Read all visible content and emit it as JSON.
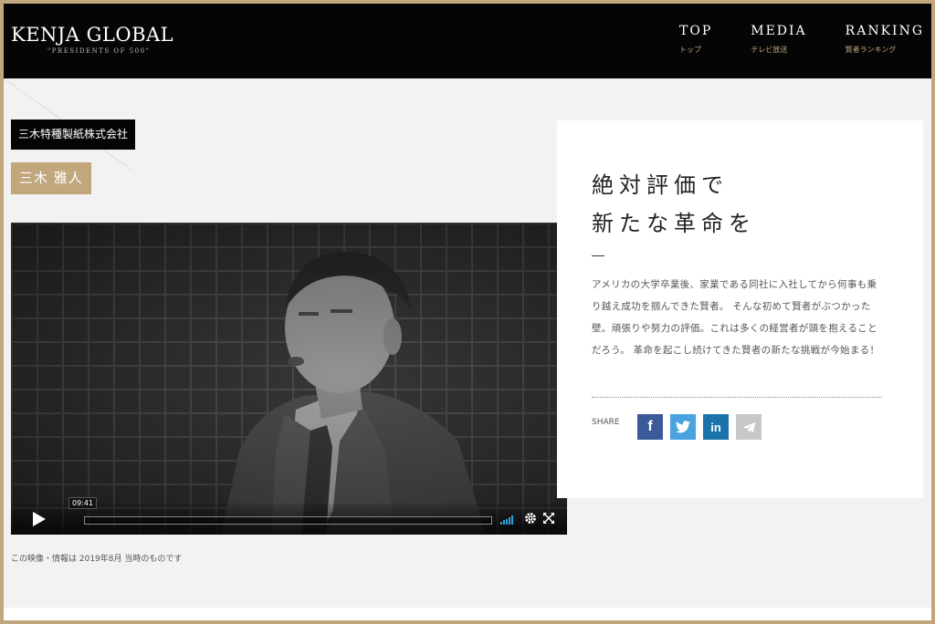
{
  "header": {
    "logo_title": "KENJA GLOBAL",
    "logo_subtitle": "\"PRESIDENTS OF 500\"",
    "nav": [
      {
        "en": "TOP",
        "jp": "トップ"
      },
      {
        "en": "MEDIA",
        "jp": "テレビ放送"
      },
      {
        "en": "RANKING",
        "jp": "賢者ランキング"
      }
    ]
  },
  "profile": {
    "company": "三木特種製紙株式会社",
    "name": "三木 雅人"
  },
  "video": {
    "duration": "09:41",
    "progress": 0,
    "caption": "この映像・情報は 2019年8月 当時のものです"
  },
  "article": {
    "headline_line1": "絶対評価で",
    "headline_line2": "新たな革命を",
    "description": "アメリカの大学卒業後、家業である同社に入社してから何事も乗り越え成功を掴んできた賢者。 そんな初めて賢者がぶつかった壁。頑張りや努力の評価。これは多くの経営者が頭を抱えることだろう。 革命を起こし続けてきた賢者の新たな挑戦が今始まる！",
    "share_label": "SHARE",
    "share_buttons": [
      {
        "name": "facebook",
        "glyph": "f",
        "color": "#3b5a9a"
      },
      {
        "name": "twitter",
        "color": "#4aa3df"
      },
      {
        "name": "linkedin",
        "glyph": "in",
        "color": "#1c73ac"
      },
      {
        "name": "telegram",
        "color": "#c7c7c7"
      }
    ]
  },
  "colors": {
    "gold": "#c2a77c",
    "black": "#050505",
    "vimeo_blue": "#2aa3e4"
  }
}
